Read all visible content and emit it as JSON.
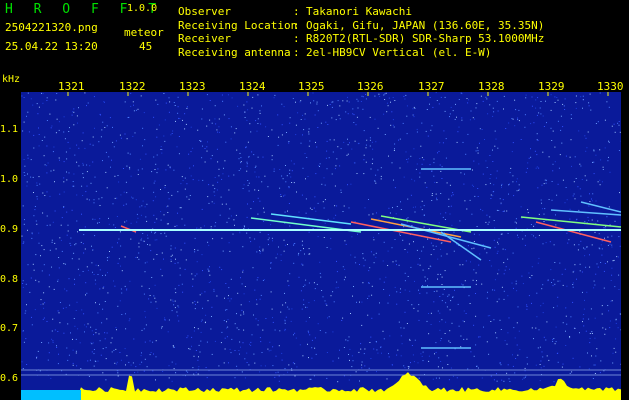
{
  "app": {
    "logo": "H R O F F T",
    "version": "1.0.0"
  },
  "capture": {
    "filename": "2504221320.png",
    "timestamp": "25.04.22 13:20",
    "meteor_label": "meteor",
    "meteor_count": "45"
  },
  "metadata": [
    {
      "label": "Observer",
      "value": "Takanori Kawachi"
    },
    {
      "label": "Receiving Location",
      "value": "Ogaki, Gifu, JAPAN (136.60E, 35.35N)"
    },
    {
      "label": "Receiver",
      "value": "R820T2(RTL-SDR) SDR-Sharp 53.1000MHz"
    },
    {
      "label": "Receiving antenna",
      "value": "2el-HB9CV Vertical (el. E-W)"
    }
  ],
  "axes": {
    "y_unit": "kHz",
    "y_ticks": [
      "1.1",
      "1.0",
      "0.9",
      "0.8",
      "0.7",
      "0.6"
    ],
    "x_ticks": [
      "1321",
      "1322",
      "1323",
      "1324",
      "1325",
      "1326",
      "1327",
      "1328",
      "1329",
      "1330"
    ]
  },
  "colors": {
    "background": "#000000",
    "spectrogram_base": "#0a1a9a",
    "carrier": "#aaffff",
    "label_yellow": "#ffff00",
    "logo_green": "#00e000"
  }
}
